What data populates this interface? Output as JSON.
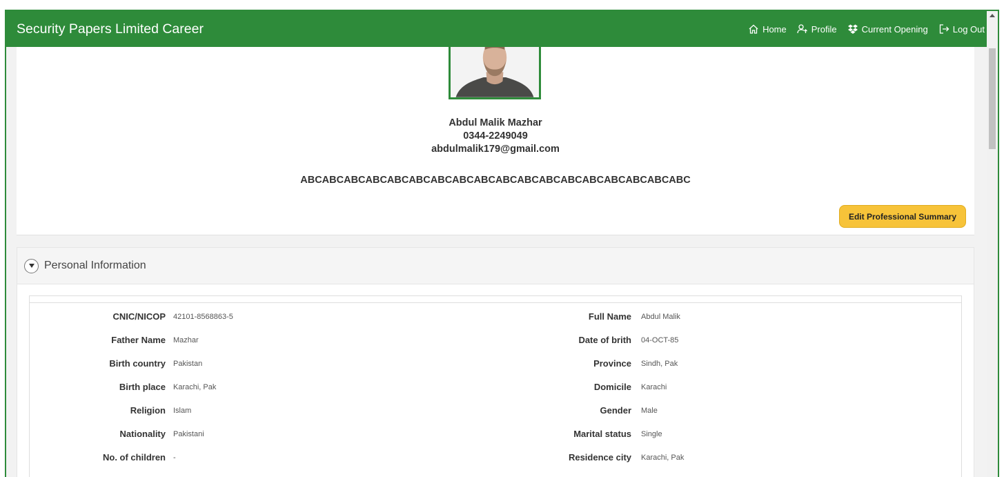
{
  "navbar": {
    "brand": "Security Papers Limited Career",
    "links": {
      "home": "Home",
      "profile": "Profile",
      "current_opening": "Current Opening",
      "logout": "Log Out"
    }
  },
  "profile": {
    "name": "Abdul Malik Mazhar",
    "phone": "0344-2249049",
    "email": "abdulmalik179@gmail.com",
    "summary": "ABCABCABCABCABCABCABCABCABCABCABCABCABCABCABCABCABCABC",
    "edit_button": "Edit Professional Summary"
  },
  "personal": {
    "title": "Personal Information",
    "rows": [
      {
        "l_label": "CNIC/NICOP",
        "l_value": "42101-8568863-5",
        "r_label": "Full Name",
        "r_value": "Abdul Malik"
      },
      {
        "l_label": "Father Name",
        "l_value": "Mazhar",
        "r_label": "Date of brith",
        "r_value": "04-OCT-85"
      },
      {
        "l_label": "Birth country",
        "l_value": "Pakistan",
        "r_label": "Province",
        "r_value": "Sindh, Pak"
      },
      {
        "l_label": "Birth place",
        "l_value": "Karachi, Pak",
        "r_label": "Domicile",
        "r_value": "Karachi"
      },
      {
        "l_label": "Religion",
        "l_value": "Islam",
        "r_label": "Gender",
        "r_value": "Male"
      },
      {
        "l_label": "Nationality",
        "l_value": "Pakistani",
        "r_label": "Marital status",
        "r_value": "Single"
      },
      {
        "l_label": "No. of children",
        "l_value": "-",
        "r_label": "Residence city",
        "r_value": "Karachi, Pak"
      }
    ]
  },
  "colors": {
    "brand_green": "#2e8b3a",
    "button_yellow": "#f7c339"
  }
}
